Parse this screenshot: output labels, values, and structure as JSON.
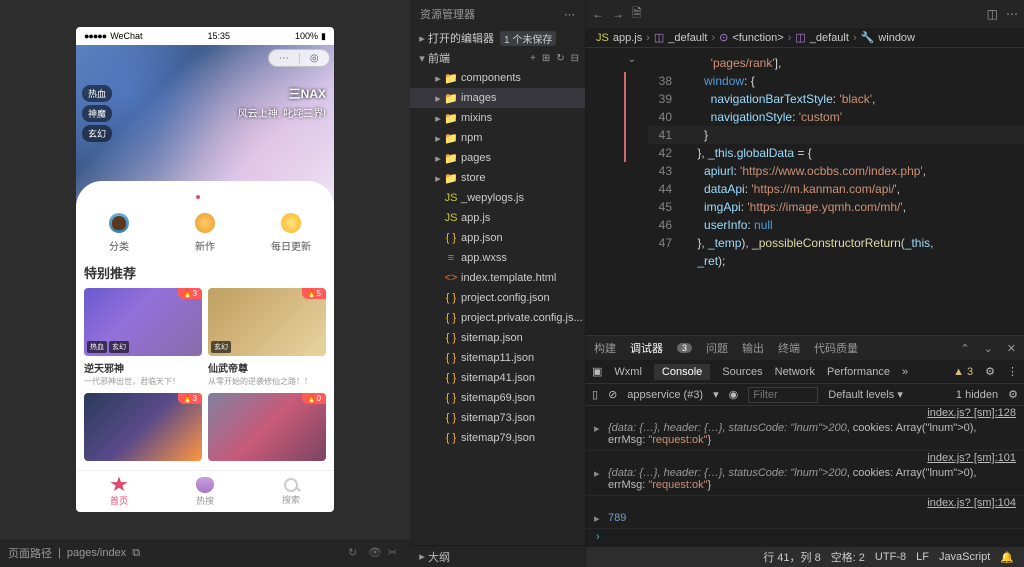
{
  "simulator": {
    "statusbar": {
      "carrier": "WeChat",
      "time": "15:35",
      "battery": "100%",
      "signal": "●●●●●"
    },
    "hero": {
      "tags": [
        "热血",
        "神魔",
        "玄幻"
      ],
      "logo": "三NAX",
      "slogan": "风云上神, 叱咤三界!"
    },
    "categories": [
      {
        "label": "分类"
      },
      {
        "label": "新作"
      },
      {
        "label": "每日更新"
      }
    ],
    "section_title": "特别推荐",
    "cards": [
      {
        "title": "逆天邪神",
        "sub": "一代邪神出世，君临天下！",
        "chips": [
          "热血",
          "玄幻"
        ],
        "badge": "🔥3"
      },
      {
        "title": "仙武帝尊",
        "sub": "从零开始的逆袭修仙之路！！",
        "chips": [
          "玄幻"
        ],
        "badge": "🔥5"
      },
      {
        "title": "",
        "sub": "",
        "chips": [],
        "badge": "🔥3"
      },
      {
        "title": "",
        "sub": "",
        "chips": [],
        "badge": "🔥0"
      }
    ],
    "nav": [
      {
        "label": "首页"
      },
      {
        "label": "热搜"
      },
      {
        "label": "搜索"
      }
    ],
    "footer": {
      "label": "页面路径",
      "path": "pages/index"
    }
  },
  "explorer": {
    "title": "资源管理器",
    "open_editors": "打开的编辑器",
    "open_badge": "1 个未保存",
    "root": "前端",
    "tree": [
      {
        "name": "components",
        "icon": "fold-g",
        "indent": 1
      },
      {
        "name": "images",
        "icon": "fold-g",
        "indent": 1,
        "sel": true,
        "caret": "▸"
      },
      {
        "name": "mixins",
        "icon": "fold",
        "indent": 1
      },
      {
        "name": "npm",
        "icon": "fold",
        "indent": 1
      },
      {
        "name": "pages",
        "icon": "fold",
        "indent": 1
      },
      {
        "name": "store",
        "icon": "fold",
        "indent": 1
      },
      {
        "name": "_wepylogs.js",
        "icon": "js",
        "indent": 1
      },
      {
        "name": "app.js",
        "icon": "js",
        "indent": 1
      },
      {
        "name": "app.json",
        "icon": "json",
        "indent": 1
      },
      {
        "name": "app.wxss",
        "icon": "wxss",
        "indent": 1
      },
      {
        "name": "index.template.html",
        "icon": "html",
        "indent": 1
      },
      {
        "name": "project.config.json",
        "icon": "json",
        "indent": 1
      },
      {
        "name": "project.private.config.js...",
        "icon": "json",
        "indent": 1
      },
      {
        "name": "sitemap.json",
        "icon": "json",
        "indent": 1
      },
      {
        "name": "sitemap11.json",
        "icon": "json",
        "indent": 1
      },
      {
        "name": "sitemap41.json",
        "icon": "json",
        "indent": 1
      },
      {
        "name": "sitemap69.json",
        "icon": "json",
        "indent": 1
      },
      {
        "name": "sitemap73.json",
        "icon": "json",
        "indent": 1
      },
      {
        "name": "sitemap79.json",
        "icon": "json",
        "indent": 1
      }
    ],
    "outline": "大纲"
  },
  "editor": {
    "breadcrumbs": [
      "app.js",
      "_default",
      "<function>",
      "_default",
      "window"
    ],
    "icons": {
      "file": "JS",
      "cube": "◫",
      "fn": "⊙",
      "wrench": "🔧"
    },
    "lines": [
      {
        "n": "",
        "t": "        'pages/rank'],",
        "cls": ""
      },
      {
        "n": 38,
        "t": "      window: {",
        "cls": ""
      },
      {
        "n": 39,
        "t": "        navigationBarTextStyle: 'black',",
        "cls": ""
      },
      {
        "n": 40,
        "t": "        navigationStyle: 'custom'",
        "cls": ""
      },
      {
        "n": 41,
        "t": "      }",
        "cls": "cur"
      },
      {
        "n": 42,
        "t": "    }, _this.globalData = {",
        "cls": ""
      },
      {
        "n": 43,
        "t": "      apiurl: 'https://www.ocbbs.com/index.php',",
        "cls": ""
      },
      {
        "n": 44,
        "t": "      dataApi: 'https://m.kanman.com/api/',",
        "cls": ""
      },
      {
        "n": 45,
        "t": "      imgApi: 'https://image.yqmh.com/mh/',",
        "cls": ""
      },
      {
        "n": 46,
        "t": "      userInfo: null",
        "cls": ""
      },
      {
        "n": 47,
        "t": "    }, _temp), _possibleConstructorReturn(_this,",
        "cls": ""
      },
      {
        "n": "",
        "t": "    _ret);",
        "cls": ""
      }
    ]
  },
  "devtools": {
    "tabs": [
      "构建",
      "调试器",
      "问题",
      "输出",
      "终端",
      "代码质量"
    ],
    "active_badge": "3",
    "subtabs": [
      "Wxml",
      "Console",
      "Sources",
      "Network",
      "Performance"
    ],
    "warn_count": "▲ 3",
    "filter": {
      "ctx": "appservice (#3)",
      "placeholder": "Filter",
      "levels": "Default levels ▾",
      "hidden": "1 hidden"
    },
    "logs": [
      {
        "src": "index.js? [sm]:128",
        "msg": "{data: {…}, header: {…}, statusCode: 200, cookies: Array(0), errMsg: \"request:ok\"}"
      },
      {
        "src": "index.js? [sm]:101",
        "msg": "{data: {…}, header: {…}, statusCode: 200, cookies: Array(0), errMsg: \"request:ok\"}"
      },
      {
        "src": "index.js? [sm]:104",
        "msg": "789",
        "num": true
      }
    ]
  },
  "statusbar": {
    "pos": "行 41，列 8",
    "spaces": "空格: 2",
    "enc": "UTF-8",
    "eol": "LF",
    "lang": "JavaScript"
  }
}
